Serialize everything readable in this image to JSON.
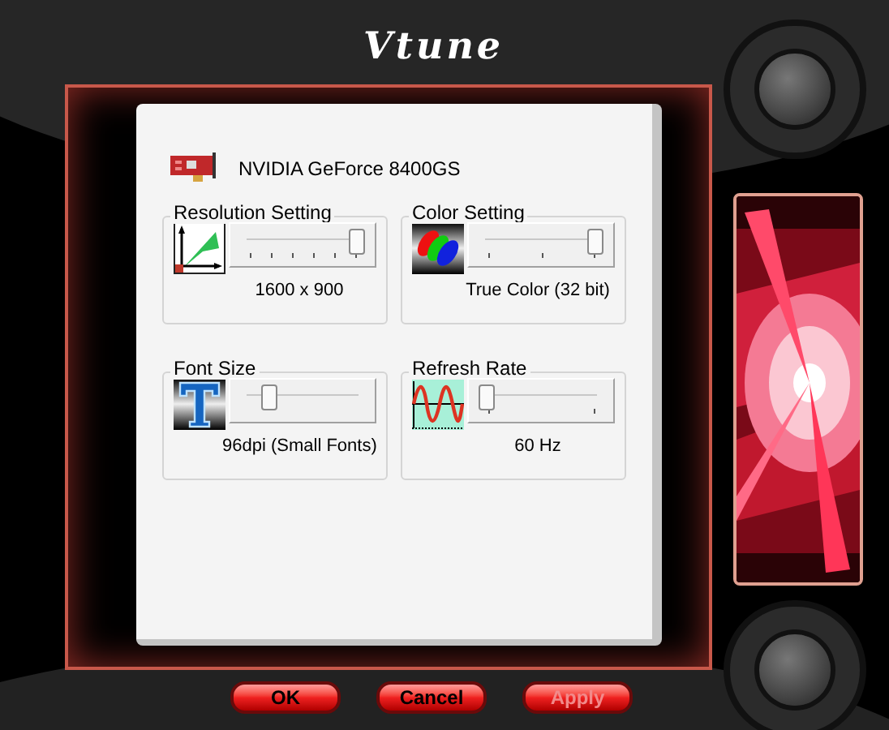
{
  "window": {
    "title": "Vtune"
  },
  "device": {
    "name": "NVIDIA GeForce 8400GS"
  },
  "groups": [
    {
      "kind": "resolution",
      "title": "Resolution Setting",
      "level": 1.0,
      "reading": "1600 x 900"
    },
    {
      "kind": "color",
      "title": "Color Setting",
      "level": 1.0,
      "reading": "True Color (32 bit)"
    },
    {
      "kind": "font",
      "title": "Font Size",
      "level": 0.2,
      "reading": "96dpi (Small Fonts)"
    },
    {
      "kind": "refresh",
      "title": "Refresh Rate",
      "level": 0.0,
      "reading": "60 Hz"
    }
  ],
  "buttons": [
    {
      "label": "OK",
      "disabled": false
    },
    {
      "label": "Cancel",
      "disabled": false
    },
    {
      "label": "Apply",
      "disabled": true
    }
  ]
}
